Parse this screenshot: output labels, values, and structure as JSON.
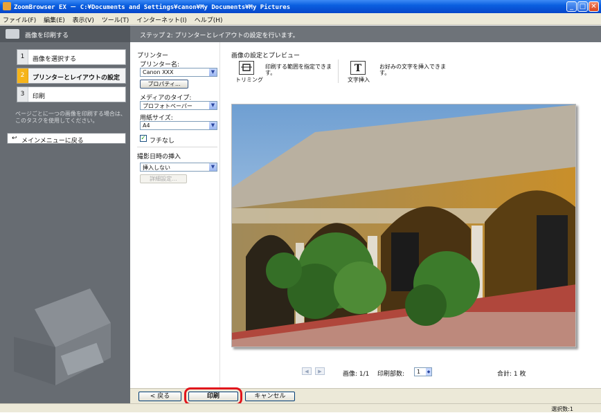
{
  "window": {
    "title": "ZoomBrowser EX － C:¥Documents and Settings¥canon¥My Documents¥My Pictures",
    "min": "_",
    "max": "□",
    "close": "✕"
  },
  "menu": [
    "ファイル(F)",
    "編集(E)",
    "表示(V)",
    "ツール(T)",
    "インターネット(I)",
    "ヘルプ(H)"
  ],
  "left_panel": {
    "header": "画像を印刷する",
    "steps": [
      {
        "num": "1",
        "label": "画像を選択する"
      },
      {
        "num": "2",
        "label": "プリンターとレイアウトの設定"
      },
      {
        "num": "3",
        "label": "印刷"
      }
    ],
    "note": "ページごとに一つの画像を印刷する場合は、このタスクを使用してください。",
    "back_button": "メインメニューに戻る"
  },
  "main_header": "ステップ 2: プリンターとレイアウトの設定を行います。",
  "settings": {
    "printer_section": "プリンター",
    "printer_name_label": "プリンター名:",
    "printer_name_value": "Canon XXX",
    "properties_button": "プロパティ...",
    "media_label": "メディアのタイプ:",
    "media_value": "プロフォトペーパー",
    "paper_label": "用紙サイズ:",
    "paper_value": "A4",
    "borderless_label": "フチなし",
    "date_section": "撮影日時の挿入",
    "date_value": "挿入しない",
    "details_button": "詳細設定..."
  },
  "preview": {
    "title": "画像の設定とプレビュー",
    "trim_label": "トリミング",
    "trim_desc": "印刷する範囲を指定できます。",
    "text_label": "文字挿入",
    "text_desc": "お好みの文字を挿入できます。"
  },
  "nav": {
    "prev": "◀",
    "next": "▶",
    "image_count": "画像: 1/1",
    "copies_label": "印刷部数:",
    "copies_value": "1",
    "total": "合計: 1 枚"
  },
  "buttons": {
    "back": "< 戻る",
    "print": "印刷",
    "cancel": "キャンセル"
  },
  "status": "選択数:1",
  "colors": {
    "highlight": "#e1141b",
    "step_active": "#f6b41a"
  }
}
